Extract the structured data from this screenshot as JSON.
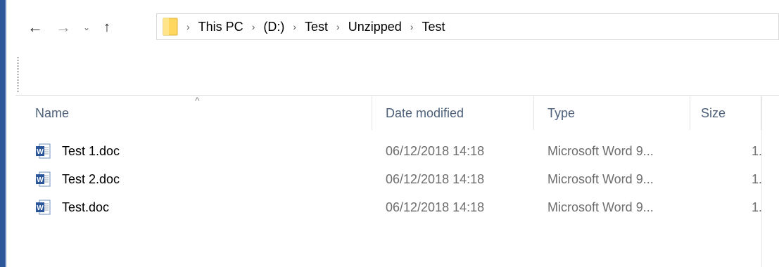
{
  "nav": {
    "back_glyph": "←",
    "forward_glyph": "→",
    "recent_glyph": "⌄",
    "up_glyph": "↑"
  },
  "address": {
    "crumbs": [
      "This PC",
      "(D:)",
      "Test",
      "Unzipped",
      "Test"
    ],
    "separator": "›"
  },
  "columns": {
    "name": "Name",
    "date": "Date modified",
    "type": "Type",
    "size": "Size"
  },
  "files": [
    {
      "name": "Test 1.doc",
      "date": "06/12/2018 14:18",
      "type": "Microsoft Word 9...",
      "size": "1."
    },
    {
      "name": "Test 2.doc",
      "date": "06/12/2018 14:18",
      "type": "Microsoft Word 9...",
      "size": "1."
    },
    {
      "name": "Test.doc",
      "date": "06/12/2018 14:18",
      "type": "Microsoft Word 9...",
      "size": "1."
    }
  ],
  "colors": {
    "accent": "#2b579a",
    "header_text": "#4c607a",
    "folder": "#ffd75e"
  },
  "icons": {
    "folder": "folder-icon",
    "word": "word-document-icon"
  }
}
